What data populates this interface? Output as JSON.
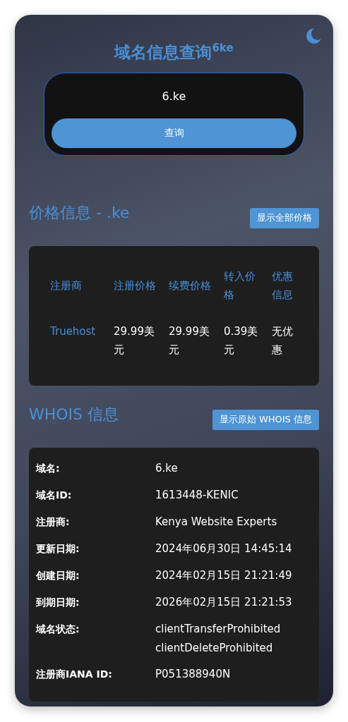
{
  "header": {
    "title": "域名信息查询$^{6ke}$"
  },
  "search": {
    "value": "6.ke",
    "button": "查询"
  },
  "pricing": {
    "heading": "价格信息 - .ke",
    "button": "显示全部价格",
    "columns": [
      "注册商",
      "注册价格",
      "续费价格",
      "转入价格",
      "优惠信息"
    ],
    "rows": [
      {
        "cells": [
          "Truehost",
          "29.99美元",
          "29.99美元",
          "0.39美元",
          "无优惠"
        ]
      }
    ]
  },
  "whois": {
    "heading": "WHOIS 信息",
    "button": "显示原始 WHOIS 信息",
    "rows": [
      {
        "label": "域名:",
        "values": [
          "6.ke"
        ]
      },
      {
        "label": "域名ID:",
        "values": [
          "1613448-KENIC"
        ]
      },
      {
        "label": "注册商:",
        "values": [
          "Kenya Website Experts"
        ]
      },
      {
        "label": "更新日期:",
        "values": [
          "2024年06月30日 14:45:14"
        ]
      },
      {
        "label": "创建日期:",
        "values": [
          "2024年02月15日 21:21:49"
        ]
      },
      {
        "label": "到期日期:",
        "values": [
          "2026年02月15日 21:21:53"
        ]
      },
      {
        "label": "域名状态:",
        "values": [
          "clientTransferProhibited",
          "clientDeleteProhibited"
        ]
      },
      {
        "label": "注册商IANA ID:",
        "values": [
          "P051388940N"
        ]
      }
    ]
  }
}
